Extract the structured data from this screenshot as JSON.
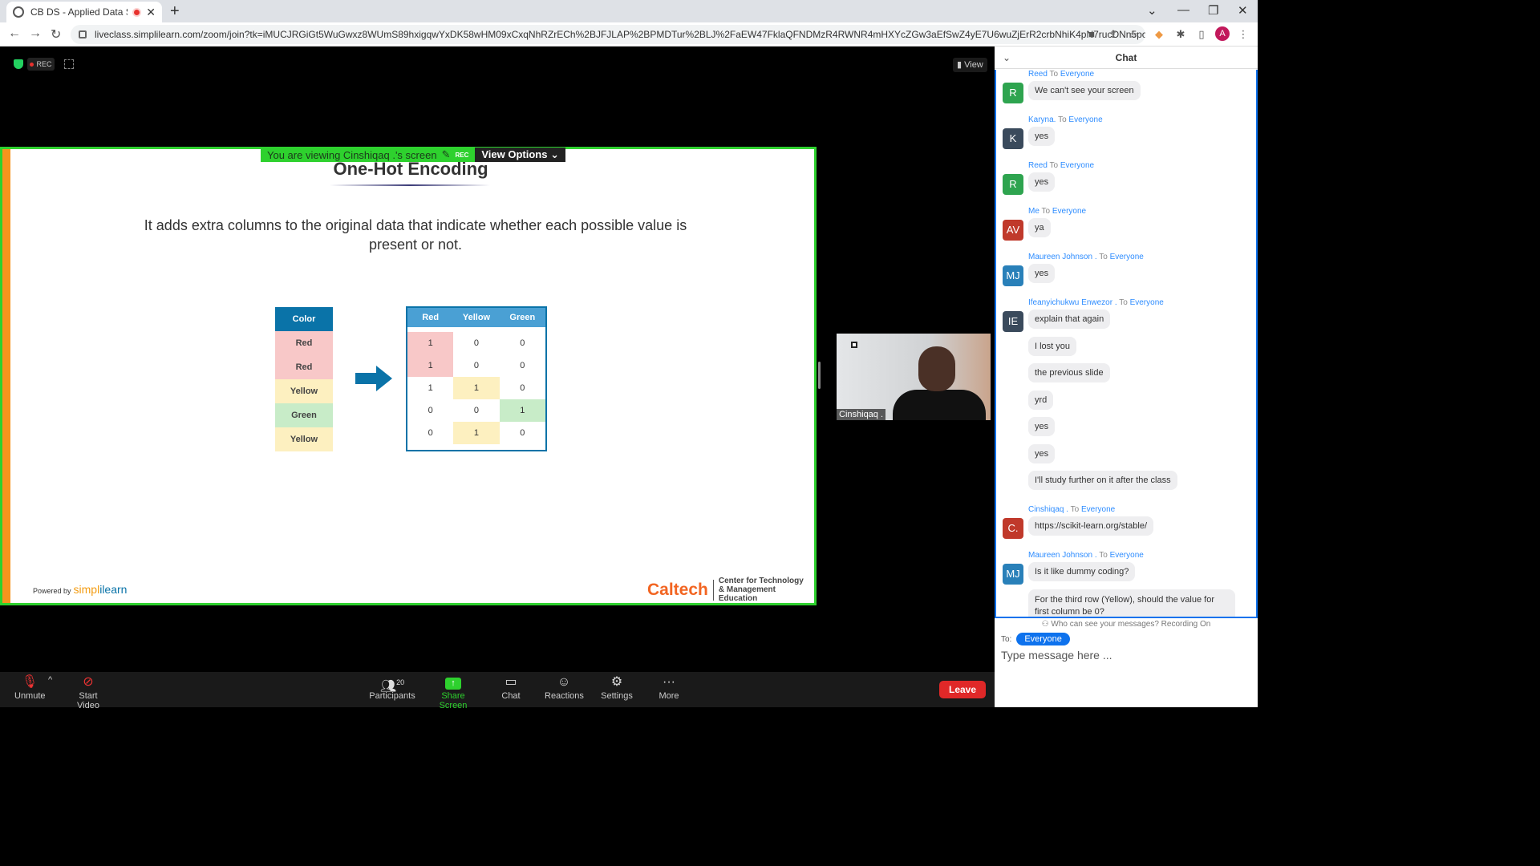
{
  "browser": {
    "tab_title": "CB DS - Applied Data Scienc",
    "url": "liveclass.simplilearn.com/zoom/join?tk=iMUCJRGiGt5WuGwxz8WUmS89hxigqwYxDK58wHM09xCxqNhRZrECh%2BJFJLAP%2BPMDTur%2BLJ%2FaEW47FklaQFNDMzR4RWNR4mHXYcZGw3aEfSwZ4yE7U6wuZjErR2crbNhiK4pN7rucDNn5pcxSOy6...",
    "profile_initial": "A"
  },
  "meeting": {
    "rec_label": "REC",
    "view_label": "View",
    "viewing_banner": "You are viewing Cinshiqaq .'s screen",
    "banner_rec": "REC",
    "view_options": "View Options ⌄",
    "video_name": "Cinshiqaq ."
  },
  "slide": {
    "title": "One-Hot Encoding",
    "text": "It adds extra columns to the original data that indicate whether each possible value is present or not.",
    "color_header": "Color",
    "colors": [
      "Red",
      "Red",
      "Yellow",
      "Green",
      "Yellow"
    ],
    "onehot_headers": [
      "Red",
      "Yellow",
      "Green"
    ],
    "onehot_rows": [
      [
        "1",
        "0",
        "0"
      ],
      [
        "1",
        "0",
        "0"
      ],
      [
        "1",
        "1",
        "0"
      ],
      [
        "0",
        "0",
        "1"
      ],
      [
        "0",
        "1",
        "0"
      ]
    ],
    "powered_by": "Powered by",
    "brand_a": "simpl",
    "brand_b": "ilearn",
    "caltech": "Caltech",
    "caltech_sub": "Center for Technology & Management Education"
  },
  "toolbar": {
    "unmute": "Unmute",
    "start_video": "Start Video",
    "participants": "Participants",
    "participants_count": "20",
    "share_screen": "Share Screen",
    "chat": "Chat",
    "reactions": "Reactions",
    "settings": "Settings",
    "more": "More",
    "leave": "Leave"
  },
  "chat": {
    "title": "Chat",
    "to_word": "To",
    "messages": [
      {
        "sender": "Reed",
        "to": "Everyone",
        "initials": "R",
        "color": "#2ea44f",
        "texts": [
          "We can't see your screen"
        ]
      },
      {
        "sender": "Karyna.",
        "to": "Everyone",
        "initials": "K",
        "color": "#3a4a5c",
        "texts": [
          "yes"
        ]
      },
      {
        "sender": "Reed",
        "to": "Everyone",
        "initials": "R",
        "color": "#2ea44f",
        "texts": [
          "yes"
        ]
      },
      {
        "sender": "Me",
        "to": "Everyone",
        "initials": "AV",
        "color": "#c0392b",
        "texts": [
          "ya"
        ]
      },
      {
        "sender": "Maureen Johnson .",
        "to": "Everyone",
        "initials": "MJ",
        "color": "#2980b9",
        "texts": [
          "yes"
        ]
      },
      {
        "sender": "Ifeanyichukwu Enwezor .",
        "to": "Everyone",
        "initials": "IE",
        "color": "#3a4a5c",
        "texts": [
          "explain that again",
          "I lost you",
          "the previous slide",
          "yrd",
          "yes",
          "yes",
          "I'll study further on it after the class"
        ]
      },
      {
        "sender": "Cinshiqaq .",
        "to": "Everyone",
        "initials": "C.",
        "color": "#c0392b",
        "texts": [
          "https://scikit-learn.org/stable/"
        ]
      },
      {
        "sender": "Maureen Johnson .",
        "to": "Everyone",
        "initials": "MJ",
        "color": "#2980b9",
        "texts": [
          "Is it like dummy coding?",
          "For the third row (Yellow), should the value for first column be 0?"
        ]
      }
    ],
    "who_can_see": "Who can see your messages? Recording On",
    "to_label": "To:",
    "recipient": "Everyone",
    "placeholder": "Type message here ..."
  }
}
